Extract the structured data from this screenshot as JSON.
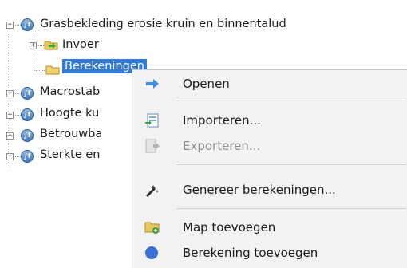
{
  "tree": {
    "root": {
      "label": "Grasbekleding erosie kruin en binnentalud"
    },
    "children": [
      {
        "label": "Invoer"
      },
      {
        "label": "Berekeningen"
      }
    ],
    "siblings": [
      {
        "label": "Macrostab"
      },
      {
        "label": "Hoogte ku"
      },
      {
        "label": "Betrouwba"
      },
      {
        "label": "Sterkte en"
      }
    ]
  },
  "context_menu": {
    "items": [
      {
        "label": "Openen",
        "icon": "arrow-right-icon",
        "enabled": true
      },
      {
        "label": "Importeren...",
        "icon": "import-icon",
        "enabled": true
      },
      {
        "label": "Exporteren...",
        "icon": "export-icon",
        "enabled": false
      },
      {
        "label": "Genereer berekeningen...",
        "icon": "wand-icon",
        "enabled": true
      },
      {
        "label": "Map toevoegen",
        "icon": "folder-add-icon",
        "enabled": true
      },
      {
        "label": "Berekening toevoegen",
        "icon": "calculation-icon",
        "enabled": true
      }
    ]
  },
  "colors": {
    "selection": "#2f7be0",
    "menu_bg": "#f2f2f2"
  }
}
